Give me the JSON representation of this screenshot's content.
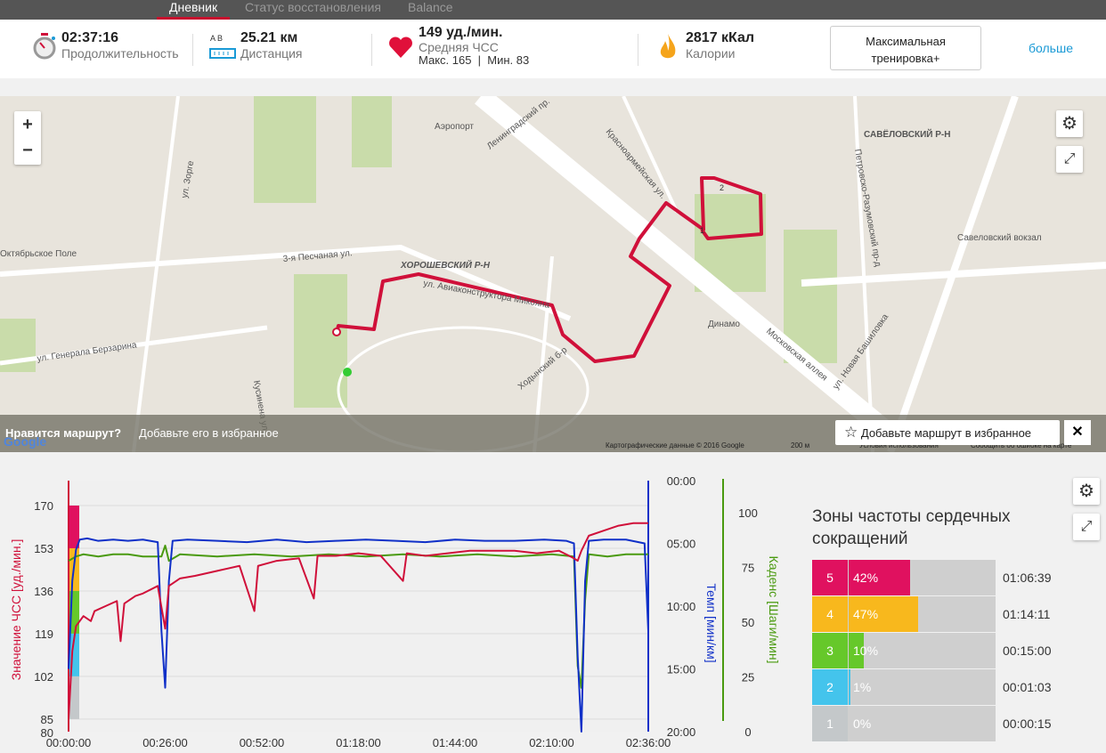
{
  "tabs": [
    {
      "label": "Дневник",
      "active": true
    },
    {
      "label": "Статус восстановления"
    },
    {
      "label": "Balance"
    }
  ],
  "stats": {
    "duration": {
      "value": "02:37:16",
      "label": "Продолжительность"
    },
    "distance": {
      "ab": "A  B",
      "value": "25.21 км",
      "label": "Дистанция"
    },
    "hr": {
      "value": "149 уд./мин.",
      "label": "Средняя ЧСС",
      "minmax": "Макс. 165  |  Мин. 83"
    },
    "calories": {
      "value": "2817 кКал",
      "label": "Калории"
    },
    "training_button": "Максимальная тренировка+",
    "more": "больше"
  },
  "map": {
    "zoom_in": "+",
    "zoom_out": "−",
    "labels": [
      "ХОРОШЕВСКИЙ Р-Н",
      "САВЁЛОВСКИЙ Р-Н",
      "Аэропорт",
      "Динамо",
      "Савеловский вокзал",
      "Ленинградский пр.",
      "3-я Песчаная ул.",
      "ул. Генерала Берзарина",
      "Московская аллея",
      "ул. Новая Башиловка",
      "ул. Авиаконструктора Микояна",
      "Ходынский б-р",
      "Красноармейская ул.",
      "Петровско-Разумовский пр-д",
      "ул. Зорге",
      "Октябрьское Поле",
      "Кусинена ул."
    ],
    "route_markers": [
      "1",
      "2"
    ],
    "banner_question": "Нравится маршрут?",
    "banner_text": "Добавьте его в избранное",
    "add_favorite": "Добавьте маршрут в избранное",
    "copyright": "Картографические данные © 2016 Google",
    "scale": "200 м",
    "terms": "Условия использования",
    "report": "Сообщить об ошибке на карте",
    "google": "Google"
  },
  "chart_data": {
    "type": "line",
    "x_ticks": [
      "00:00:00",
      "00:26:00",
      "00:52:00",
      "01:18:00",
      "01:44:00",
      "02:10:00",
      "02:36:00"
    ],
    "x_range_min": [
      0,
      156
    ],
    "hr_axis": {
      "label": "Значение ЧСС [уд./мин.]",
      "ticks": [
        "170",
        "153",
        "136",
        "119",
        "102",
        "85",
        "80"
      ],
      "range": [
        80,
        170
      ]
    },
    "pace_axis": {
      "label": "Темп [мин/км]",
      "ticks": [
        "00:00",
        "05:00",
        "10:00",
        "15:00",
        "20:00"
      ],
      "range": [
        0,
        20
      ]
    },
    "cadence_axis": {
      "label": "Каденс [Шаги/мин]",
      "ticks": [
        "100",
        "75",
        "50",
        "25",
        "0"
      ],
      "range": [
        0,
        115
      ]
    },
    "series": [
      {
        "name": "ЧСС",
        "color": "#d0103a",
        "x": [
          0,
          1,
          2,
          4,
          6,
          7,
          10,
          13,
          14,
          15,
          18,
          20,
          24,
          26,
          27,
          30,
          34,
          40,
          46,
          50,
          51,
          56,
          62,
          66,
          67,
          72,
          78,
          84,
          90,
          91,
          96,
          102,
          108,
          114,
          120,
          126,
          132,
          136,
          137,
          138,
          140,
          144,
          148,
          152,
          156
        ],
        "y": [
          85,
          112,
          122,
          126,
          124,
          128,
          130,
          132,
          116,
          131,
          134,
          135,
          138,
          121,
          138,
          141,
          142,
          144,
          146,
          128,
          146,
          148,
          149,
          133,
          150,
          150,
          151,
          150,
          140,
          151,
          150,
          151,
          152,
          152,
          152,
          151,
          152,
          149,
          148,
          152,
          158,
          160,
          162,
          163,
          163
        ]
      },
      {
        "name": "Темп",
        "color": "#1030c8",
        "x": [
          0,
          1,
          2,
          3,
          5,
          8,
          12,
          16,
          20,
          24,
          25,
          26,
          27,
          28,
          32,
          40,
          48,
          56,
          60,
          64,
          72,
          80,
          88,
          96,
          104,
          112,
          120,
          128,
          134,
          136,
          137,
          138,
          139,
          140,
          144,
          150,
          155,
          156
        ],
        "y": [
          15,
          8,
          5.5,
          4.7,
          4.6,
          4.8,
          4.7,
          4.8,
          4.7,
          4.9,
          12,
          16.5,
          8,
          4.8,
          4.7,
          4.8,
          4.9,
          4.7,
          4.8,
          4.9,
          4.8,
          4.7,
          4.8,
          4.9,
          4.7,
          4.8,
          4.8,
          4.7,
          4.8,
          5,
          14,
          20,
          8,
          4.8,
          4.7,
          4.7,
          5,
          12
        ]
      },
      {
        "name": "Каденс",
        "color": "#4a9a10",
        "x": [
          0,
          1,
          2,
          4,
          8,
          12,
          16,
          20,
          25,
          26,
          27,
          30,
          40,
          50,
          60,
          70,
          80,
          90,
          100,
          110,
          120,
          130,
          136,
          137,
          138,
          139,
          140,
          145,
          150,
          156
        ],
        "y": [
          78,
          79,
          80,
          81,
          80,
          81,
          81,
          80,
          80,
          85,
          78,
          81,
          80,
          81,
          80,
          81,
          80,
          81,
          80,
          81,
          80,
          81,
          80,
          30,
          20,
          60,
          81,
          80,
          81,
          81
        ]
      }
    ],
    "zones": [
      {
        "color": "#e0e0e0"
      }
    ]
  },
  "hr_zones": {
    "title": "Зоны частоты сердечных сокращений",
    "rows": [
      {
        "zone": "5",
        "pct": "42%",
        "frac": 0.42,
        "time": "01:06:39",
        "color": "#e0115f"
      },
      {
        "zone": "4",
        "pct": "47%",
        "frac": 0.47,
        "time": "01:14:11",
        "color": "#f8b81d"
      },
      {
        "zone": "3",
        "pct": "10%",
        "frac": 0.1,
        "time": "00:15:00",
        "color": "#66c82a"
      },
      {
        "zone": "2",
        "pct": "1%",
        "frac": 0.01,
        "time": "00:01:03",
        "color": "#44c4ec"
      },
      {
        "zone": "1",
        "pct": "0%",
        "frac": 0.0,
        "time": "00:00:15",
        "color": "#c4c8ca"
      }
    ]
  }
}
